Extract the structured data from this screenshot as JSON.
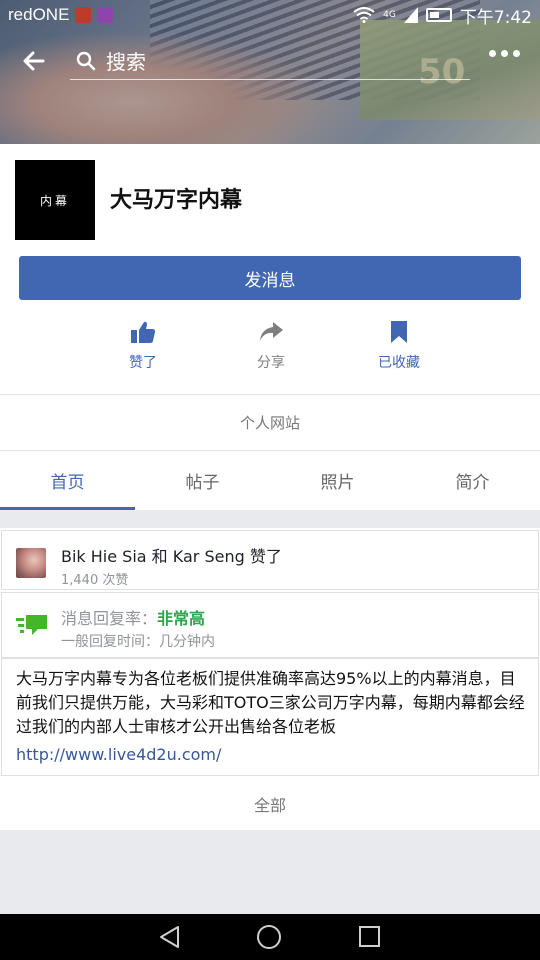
{
  "status_bar": {
    "carrier": "redONE",
    "network": "4G",
    "time": "下午7:42"
  },
  "header": {
    "search_placeholder": "搜索",
    "back_icon": "back-arrow-icon",
    "more_icon": "more-dots-icon"
  },
  "page": {
    "avatar_text": "内幕",
    "name": "大马万字内幕",
    "message_button": "发消息"
  },
  "actions": [
    {
      "label": "赞了",
      "icon": "thumbs-up-icon"
    },
    {
      "label": "分享",
      "icon": "share-icon"
    },
    {
      "label": "已收藏",
      "icon": "bookmark-icon"
    }
  ],
  "website_label": "个人网站",
  "tabs": [
    {
      "label": "首页",
      "active": true
    },
    {
      "label": "帖子",
      "active": false
    },
    {
      "label": "照片",
      "active": false
    },
    {
      "label": "简介",
      "active": false
    }
  ],
  "likes": {
    "friends_text": "Bik Hie Sia 和 Kar Seng 赞了",
    "count_text": "1,440 次赞"
  },
  "response": {
    "rate_label": "消息回复率：",
    "rate_value": "非常高",
    "time_text": "一般回复时间：几分钟内"
  },
  "about": {
    "description": "大马万字内幕专为各位老板们提供准确率高达95%以上的内幕消息，目前我们只提供万能，大马彩和TOTO三家公司万字内幕，每期内幕都会经过我们的内部人士审核才公开出售给各位老板",
    "url": "http://www.live4d2u.com/"
  },
  "all_label": "全部",
  "colors": {
    "brand_blue": "#4267b2",
    "response_green": "#2ea44f"
  }
}
